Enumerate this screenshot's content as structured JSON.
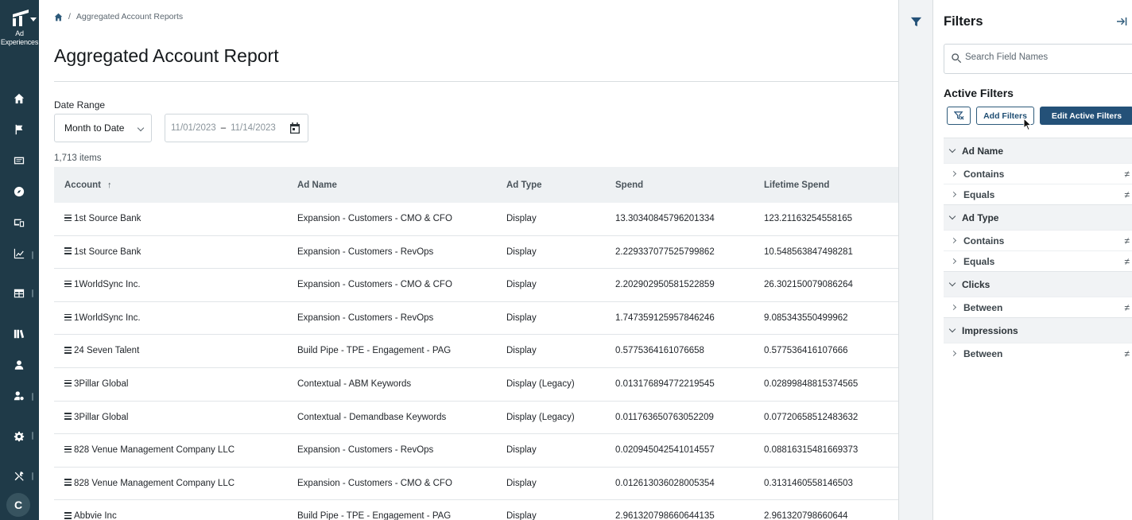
{
  "nav": {
    "brand_line1": "Ad",
    "brand_line2": "Experiences",
    "avatar_initial": "C",
    "items": [
      "home",
      "campaigns",
      "ads",
      "account",
      "devices",
      "analytics",
      "reports",
      "library",
      "audience",
      "manage",
      "settings",
      "tools"
    ]
  },
  "breadcrumb": {
    "current": "Aggregated Account Reports"
  },
  "page": {
    "title": "Aggregated Account Report"
  },
  "filters_bar": {
    "date_range_label": "Date Range",
    "preset_value": "Month to Date",
    "start_date": "11/01/2023",
    "separator": "–",
    "end_date": "11/14/2023",
    "items_count": "1,713 items"
  },
  "table": {
    "columns": [
      "Account",
      "Ad Name",
      "Ad Type",
      "Spend",
      "Lifetime Spend"
    ],
    "rows": [
      {
        "account": "1st Source Bank",
        "ad_name": "Expansion - Customers - CMO & CFO",
        "ad_type": "Display",
        "spend": "13.30340845796201334",
        "lifetime_spend": "123.21163254558165"
      },
      {
        "account": "1st Source Bank",
        "ad_name": "Expansion - Customers - RevOps",
        "ad_type": "Display",
        "spend": "2.229337077525799862",
        "lifetime_spend": "10.548563847498281"
      },
      {
        "account": "1WorldSync Inc.",
        "ad_name": "Expansion - Customers - CMO & CFO",
        "ad_type": "Display",
        "spend": "2.202902950581522859",
        "lifetime_spend": "26.302150079086264"
      },
      {
        "account": "1WorldSync Inc.",
        "ad_name": "Expansion - Customers - RevOps",
        "ad_type": "Display",
        "spend": "1.747359125957846246",
        "lifetime_spend": "9.085343550499962"
      },
      {
        "account": "24 Seven Talent",
        "ad_name": "Build Pipe - TPE - Engagement - PAG",
        "ad_type": "Display",
        "spend": "0.5775364161076658",
        "lifetime_spend": "0.577536416107666"
      },
      {
        "account": "3Pillar Global",
        "ad_name": "Contextual - ABM Keywords",
        "ad_type": "Display (Legacy)",
        "spend": "0.013176894772219545",
        "lifetime_spend": "0.02899848815374565"
      },
      {
        "account": "3Pillar Global",
        "ad_name": "Contextual - Demandbase Keywords",
        "ad_type": "Display (Legacy)",
        "spend": "0.011763650763052209",
        "lifetime_spend": "0.07720658512483632"
      },
      {
        "account": "828 Venue Management Company LLC",
        "ad_name": "Expansion - Customers - RevOps",
        "ad_type": "Display",
        "spend": "0.020945042541014557",
        "lifetime_spend": "0.08816315481669373"
      },
      {
        "account": "828 Venue Management Company LLC",
        "ad_name": "Expansion - Customers - CMO & CFO",
        "ad_type": "Display",
        "spend": "0.012613036028005354",
        "lifetime_spend": "0.3131460558146503"
      },
      {
        "account": "Abbvie Inc",
        "ad_name": "Build Pipe - TPE - Engagement - PAG",
        "ad_type": "Display",
        "spend": "2.961320798660644135",
        "lifetime_spend": "2.961320798660644"
      }
    ]
  },
  "filter_panel": {
    "title": "Filters",
    "search_placeholder": "Search Field Names",
    "active_title": "Active Filters",
    "add_label": "Add Filters",
    "edit_label": "Edit Active Filters",
    "groups": [
      {
        "name": "Ad Name",
        "items": [
          "Contains",
          "Equals"
        ]
      },
      {
        "name": "Ad Type",
        "items": [
          "Contains",
          "Equals"
        ]
      },
      {
        "name": "Clicks",
        "items": [
          "Between"
        ]
      },
      {
        "name": "Impressions",
        "items": [
          "Between"
        ]
      }
    ],
    "neq_symbol": "≠"
  },
  "colors": {
    "rail": "#1f3a48",
    "accent": "#245178",
    "header_bg": "#eef1f3"
  }
}
